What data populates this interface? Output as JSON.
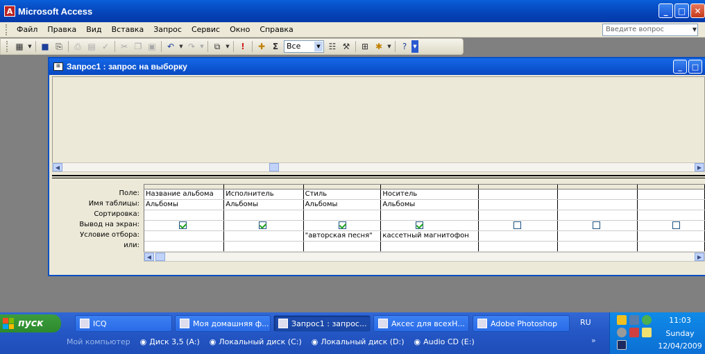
{
  "app": {
    "title": "Microsoft Access",
    "icon": "access-app-icon"
  },
  "window_buttons": {
    "minimize": "_",
    "maximize": "□",
    "close": "✕"
  },
  "menu": {
    "items": [
      "Файл",
      "Правка",
      "Вид",
      "Вставка",
      "Запрос",
      "Сервис",
      "Окно",
      "Справка"
    ],
    "ask_placeholder": "Введите вопрос"
  },
  "toolbar": {
    "combo_value": "Все"
  },
  "query_window": {
    "title": "Запрос1 : запрос на выборку",
    "row_labels": [
      "Поле:",
      "Имя таблицы:",
      "Сортировка:",
      "Вывод на экран:",
      "Условие отбора:",
      "или:"
    ],
    "columns": [
      {
        "field": "Название альбома",
        "table": "Альбомы",
        "sort": "",
        "show": true,
        "criteria": "",
        "or": ""
      },
      {
        "field": "Исполнитель",
        "table": "Альбомы",
        "sort": "",
        "show": true,
        "criteria": "",
        "or": ""
      },
      {
        "field": "Стиль",
        "table": "Альбомы",
        "sort": "",
        "show": true,
        "criteria": "\"авторская песня\"",
        "or": ""
      },
      {
        "field": "Носитель",
        "table": "Альбомы",
        "sort": "",
        "show": true,
        "criteria": "кассетный магнитофон",
        "or": ""
      },
      {
        "field": "",
        "table": "",
        "sort": "",
        "show": false,
        "criteria": "",
        "or": ""
      },
      {
        "field": "",
        "table": "",
        "sort": "",
        "show": false,
        "criteria": "",
        "or": ""
      },
      {
        "field": "",
        "table": "",
        "sort": "",
        "show": false,
        "criteria": "",
        "or": ""
      }
    ]
  },
  "taskbar": {
    "start_label": "пуск",
    "tasks": [
      {
        "label": "ICQ",
        "icon": "icq-flower-icon",
        "active": false
      },
      {
        "label": "Моя домашняя ф...",
        "icon": "folder-window-icon",
        "active": false
      },
      {
        "label": "Запрос1 : запрос...",
        "icon": "query-window-icon",
        "active": true
      },
      {
        "label": "Аксес для всехН...",
        "icon": "word-document-icon",
        "active": false
      },
      {
        "label": "Adobe Photoshop",
        "icon": "photoshop-icon",
        "active": false
      }
    ],
    "language": "RU",
    "quick_launch": [
      {
        "label": "Мой компьютер",
        "icon": "my-computer-icon",
        "muted": true
      },
      {
        "label": "Диск 3,5 (A:)",
        "icon": "floppy-drive-icon",
        "muted": false
      },
      {
        "label": "Локальный диск (C:)",
        "icon": "hard-drive-icon",
        "muted": false
      },
      {
        "label": "Локальный диск (D:)",
        "icon": "hard-drive-icon",
        "muted": false
      },
      {
        "label": "Audio CD (E:)",
        "icon": "cd-drive-icon",
        "muted": false
      }
    ],
    "more": "»",
    "clock": {
      "time": "11:03",
      "day": "Sunday",
      "date": "12/04/2009"
    }
  }
}
